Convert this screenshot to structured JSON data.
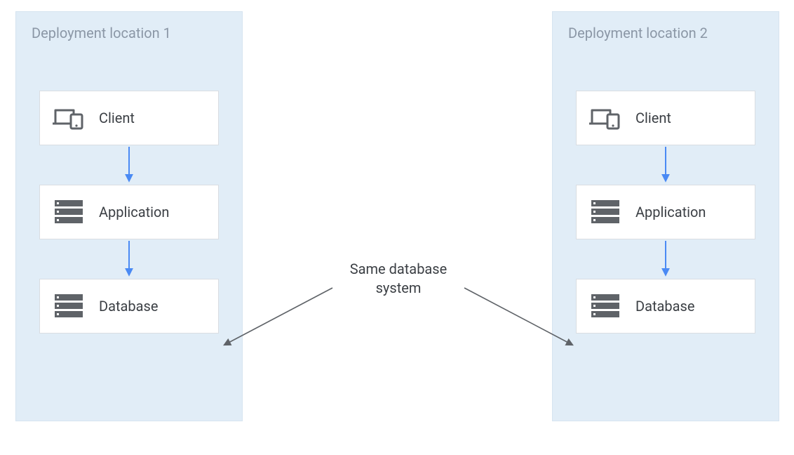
{
  "regions": [
    {
      "title": "Deployment location 1"
    },
    {
      "title": "Deployment location 2"
    }
  ],
  "nodes": {
    "client": "Client",
    "application": "Application",
    "database": "Database"
  },
  "center_note": {
    "line1": "Same database",
    "line2": "system"
  },
  "colors": {
    "region_bg": "#e1edf7",
    "arrow_blue": "#4a8af4",
    "arrow_gray": "#5f6368",
    "icon_gray": "#5f6368",
    "text_gray": "#8b97a6"
  }
}
